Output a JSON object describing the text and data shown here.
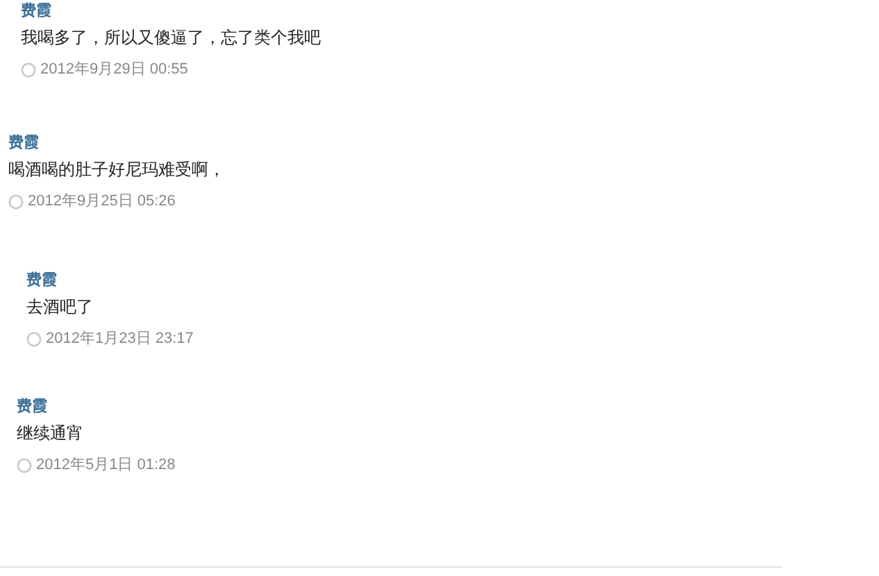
{
  "posts": [
    {
      "author": "费霞",
      "text": "我喝多了，所以又傻逼了，忘了类个我吧",
      "time": "2012年9月29日 00:55"
    },
    {
      "author": "费霞",
      "text": "喝酒喝的肚子好尼玛难受啊，",
      "time": "2012年9月25日 05:26"
    },
    {
      "author": "费霞",
      "text": "去酒吧了",
      "time": "2012年1月23日 23:17"
    },
    {
      "author": "费霞",
      "text": "继续通宵",
      "time": "2012年5月1日 01:28"
    }
  ]
}
